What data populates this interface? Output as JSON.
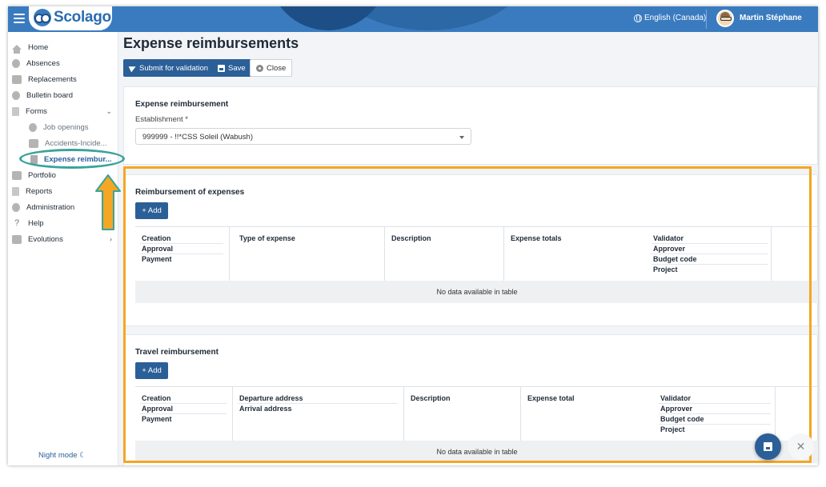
{
  "topbar": {
    "brand": "Scolago",
    "language": "English (Canada)",
    "user_name": "Martin Stéphane"
  },
  "sidebar": {
    "items": [
      {
        "label": "Home",
        "icon": "home-icon"
      },
      {
        "label": "Absences",
        "icon": "user-icon"
      },
      {
        "label": "Replacements",
        "icon": "replacements-icon"
      },
      {
        "label": "Bulletin board",
        "icon": "bulletin-icon"
      },
      {
        "label": "Forms",
        "icon": "forms-icon"
      },
      {
        "label": "Job openings",
        "icon": "user-add-icon"
      },
      {
        "label": "Accidents-Incide...",
        "icon": "accident-icon"
      },
      {
        "label": "Expense reimbur...",
        "icon": "document-icon"
      },
      {
        "label": "Portfolio",
        "icon": "trophy-icon"
      },
      {
        "label": "Reports",
        "icon": "reports-icon"
      },
      {
        "label": "Administration",
        "icon": "gear-icon"
      },
      {
        "label": "Help",
        "icon": "help-icon"
      },
      {
        "label": "Evolutions",
        "icon": "sprout-icon"
      }
    ],
    "night_mode": "Night mode ☾"
  },
  "page": {
    "title": "Expense reimbursements",
    "toolbar": {
      "submit": "Submit for validation",
      "save": "Save",
      "close": "Close"
    }
  },
  "expense_form": {
    "title": "Expense reimbursement",
    "establishment_label": "Establishment *",
    "establishment_value": "999999 - !!*CSS Soleil (Wabush)"
  },
  "reimbursement_section": {
    "title": "Reimbursement of expenses",
    "add_label": "+ Add",
    "columns": {
      "col1": [
        "Creation",
        "Approval",
        "Payment"
      ],
      "col2": "Type of expense",
      "col3": "Description",
      "col4": "Expense totals",
      "col5": [
        "Validator",
        "Approver",
        "Budget code",
        "Project"
      ]
    },
    "empty_text": "No data available in table"
  },
  "travel_section": {
    "title": "Travel reimbursement",
    "add_label": "+ Add",
    "columns": {
      "col1": [
        "Creation",
        "Approval",
        "Payment"
      ],
      "col2": [
        "Departure address",
        "Arrival address"
      ],
      "col3": "Description",
      "col4": "Expense total",
      "col5": [
        "Validator",
        "Approver",
        "Budget code",
        "Project"
      ]
    },
    "empty_text": "No data available in table"
  },
  "floating": {
    "close_glyph": "✕"
  },
  "colors": {
    "primary": "#2b5f98",
    "topbar": "#3a7bbf",
    "highlight": "#f5a623",
    "annotation": "#3aa39b"
  }
}
